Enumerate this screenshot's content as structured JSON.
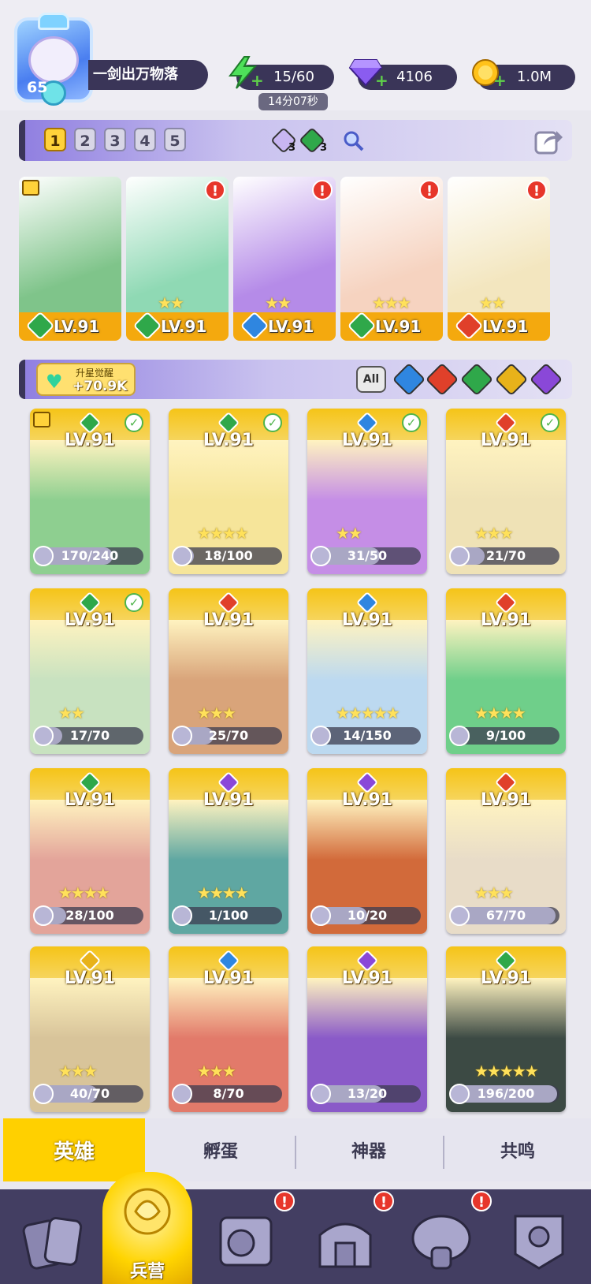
{
  "player": {
    "level": "65",
    "name": "一剑出万物落"
  },
  "resources": {
    "energy": "15/60",
    "energy_timer": "14分07秒",
    "gems": "4106",
    "coins": "1.0M"
  },
  "team_slots": [
    "1",
    "2",
    "3",
    "4",
    "5"
  ],
  "team_selected": "1",
  "team_counters": {
    "purple_count": "3",
    "green_count": "3"
  },
  "lineup": [
    {
      "level": "LV.91",
      "element": "green",
      "stars": "",
      "art": "#7fc48a",
      "alert": false,
      "tier": true
    },
    {
      "level": "LV.91",
      "element": "green",
      "stars": "★★",
      "art": "#8fd9b4",
      "alert": true
    },
    {
      "level": "LV.91",
      "element": "blue",
      "stars": "★★",
      "art": "#b58be8",
      "alert": true
    },
    {
      "level": "LV.91",
      "element": "green",
      "stars": "★★★",
      "art": "#f6d3c0",
      "alert": true
    },
    {
      "level": "LV.91",
      "element": "red",
      "stars": "★★",
      "art": "#f3e6bf",
      "alert": true
    }
  ],
  "awakening": {
    "label": "升星觉醒",
    "value": "+70.9K"
  },
  "filters": {
    "all_label": "All"
  },
  "heroes": [
    {
      "level": "LV.91",
      "element": "green",
      "progress": "170/240",
      "ratio": 0.71,
      "check": true,
      "stars": "",
      "art": "#8ecf90",
      "tier": true
    },
    {
      "level": "LV.91",
      "element": "green",
      "progress": "18/100",
      "ratio": 0.18,
      "check": true,
      "stars": "★★★★",
      "art": "#f6e59a"
    },
    {
      "level": "LV.91",
      "element": "blue",
      "progress": "31/50",
      "ratio": 0.62,
      "check": true,
      "stars": "★★",
      "art": "#c58ee6"
    },
    {
      "level": "LV.91",
      "element": "red",
      "progress": "21/70",
      "ratio": 0.3,
      "check": true,
      "stars": "★★★",
      "art": "#efe2b6"
    },
    {
      "level": "LV.91",
      "element": "green",
      "progress": "17/70",
      "ratio": 0.24,
      "check": true,
      "stars": "★★",
      "art": "#c8e2c0"
    },
    {
      "level": "LV.91",
      "element": "red",
      "progress": "25/70",
      "ratio": 0.36,
      "check": false,
      "stars": "★★★",
      "art": "#d9a47a"
    },
    {
      "level": "LV.91",
      "element": "blue",
      "progress": "14/150",
      "ratio": 0.09,
      "check": false,
      "stars": "★★★★★",
      "art": "#bcd9f0"
    },
    {
      "level": "LV.91",
      "element": "red",
      "progress": "9/100",
      "ratio": 0.09,
      "check": false,
      "stars": "★★★★",
      "art": "#6fcf8a"
    },
    {
      "level": "LV.91",
      "element": "green",
      "progress": "28/100",
      "ratio": 0.28,
      "check": false,
      "stars": "★★★★",
      "art": "#e3a49a"
    },
    {
      "level": "LV.91",
      "element": "purple",
      "progress": "1/100",
      "ratio": 0.01,
      "check": false,
      "stars": "★★★★",
      "art": "#5fa7a2"
    },
    {
      "level": "LV.91",
      "element": "purple",
      "progress": "10/20",
      "ratio": 0.5,
      "check": false,
      "stars": "",
      "art": "#d26a3a"
    },
    {
      "level": "LV.91",
      "element": "red",
      "progress": "67/70",
      "ratio": 0.96,
      "check": false,
      "stars": "★★★",
      "art": "#e8dcc8"
    },
    {
      "level": "LV.91",
      "element": "yellow",
      "progress": "40/70",
      "ratio": 0.57,
      "check": false,
      "stars": "★★★",
      "art": "#d8c49a"
    },
    {
      "level": "LV.91",
      "element": "blue",
      "progress": "8/70",
      "ratio": 0.11,
      "check": false,
      "stars": "★★★",
      "art": "#e27a6a"
    },
    {
      "level": "LV.91",
      "element": "purple",
      "progress": "13/20",
      "ratio": 0.65,
      "check": false,
      "stars": "",
      "art": "#8a5ac8"
    },
    {
      "level": "LV.91",
      "element": "green",
      "progress": "196/200",
      "ratio": 0.98,
      "check": false,
      "stars": "★★★★★",
      "art": "#3c4a44"
    }
  ],
  "tabs": {
    "heroes": "英雄",
    "hatch": "孵蛋",
    "artifact": "神器",
    "resonance": "共鸣"
  },
  "nav": {
    "barracks": "兵营"
  },
  "colors": {
    "green": "#2fa84a",
    "blue": "#2f86e0",
    "red": "#e0402a",
    "purple": "#8a48d8",
    "yellow": "#e8b21a"
  }
}
